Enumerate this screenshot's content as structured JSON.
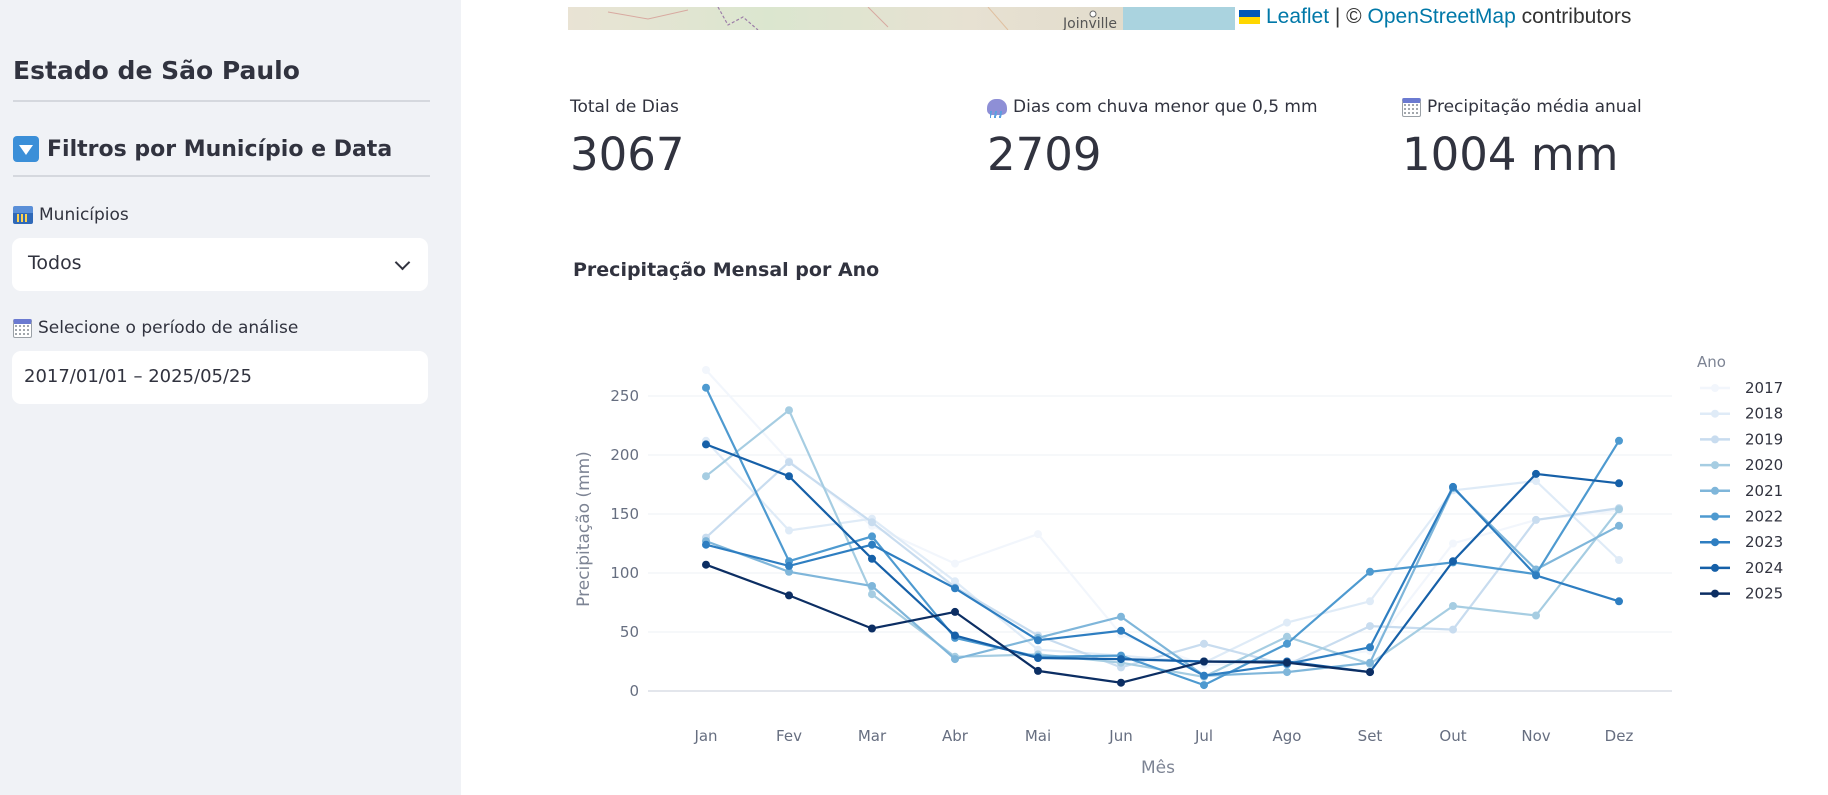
{
  "sidebar": {
    "title": "Estado de São Paulo",
    "filters_heading": "Filtros por Município e Data",
    "municipios_label": "Municípios",
    "municipios_value": "Todos",
    "periodo_label": "Selecione o período de análise",
    "periodo_value": "2017/01/01 – 2025/05/25"
  },
  "map": {
    "city_label": "Joinville",
    "attribution": {
      "leaflet": "Leaflet",
      "separator": " | © ",
      "osm": "OpenStreetMap",
      "suffix": " contributors"
    }
  },
  "metrics": {
    "total_label": "Total de Dias",
    "total_value": "3067",
    "dry_label": "Dias com chuva menor que 0,5 mm",
    "dry_value": "2709",
    "avg_label": "Precipitação média anual",
    "avg_value": "1004 mm"
  },
  "chart_title": "Precipitação Mensal por Ano",
  "chart_data": {
    "type": "line",
    "x": [
      "Jan",
      "Fev",
      "Mar",
      "Abr",
      "Mai",
      "Jun",
      "Jul",
      "Ago",
      "Set",
      "Out",
      "Nov",
      "Dez"
    ],
    "xlabel": "Mês",
    "ylabel": "Precipitação (mm)",
    "yticks": [
      0,
      50,
      100,
      150,
      200,
      250
    ],
    "ylim": [
      -12,
      270
    ],
    "legend_title": "Ano",
    "legend_position": "right",
    "grid": true,
    "series": [
      {
        "name": "2017",
        "color": "#f2f6fc",
        "values": [
          272,
          195,
          140,
          108,
          133,
          48,
          22,
          25,
          34,
          125,
          145,
          153
        ]
      },
      {
        "name": "2018",
        "color": "#dfebf7",
        "values": [
          212,
          136,
          146,
          93,
          35,
          30,
          24,
          58,
          76,
          170,
          178,
          111
        ]
      },
      {
        "name": "2019",
        "color": "#c8dcef",
        "values": [
          130,
          194,
          143,
          88,
          47,
          20,
          40,
          22,
          55,
          52,
          145,
          155
        ]
      },
      {
        "name": "2020",
        "color": "#a6cde2",
        "values": [
          182,
          238,
          82,
          29,
          31,
          24,
          12,
          46,
          23,
          72,
          64,
          154
        ]
      },
      {
        "name": "2021",
        "color": "#7fb6da",
        "values": [
          127,
          101,
          89,
          27,
          45,
          63,
          13,
          16,
          24,
          172,
          103,
          140
        ]
      },
      {
        "name": "2022",
        "color": "#4e9ad0",
        "values": [
          257,
          110,
          131,
          45,
          29,
          30,
          5,
          40,
          101,
          109,
          99,
          212
        ]
      },
      {
        "name": "2023",
        "color": "#2e7ec1",
        "values": [
          124,
          106,
          124,
          87,
          43,
          51,
          13,
          23,
          37,
          173,
          98,
          76
        ]
      },
      {
        "name": "2024",
        "color": "#1660a8",
        "values": [
          209,
          182,
          112,
          47,
          28,
          27,
          25,
          25,
          16,
          110,
          184,
          176
        ]
      },
      {
        "name": "2025",
        "color": "#0c2e63",
        "values": [
          107,
          81,
          53,
          67,
          17,
          7,
          25,
          24,
          16,
          null,
          null,
          null
        ]
      }
    ]
  }
}
